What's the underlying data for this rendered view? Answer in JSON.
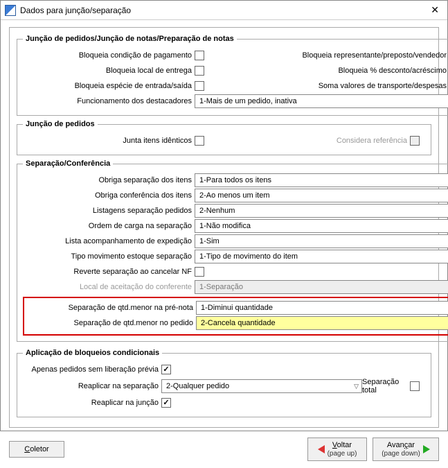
{
  "window": {
    "title": "Dados para junção/separação"
  },
  "group1": {
    "legend": "Junção de pedidos/Junção de notas/Preparação de notas",
    "left": {
      "l1": "Bloqueia condição de pagamento",
      "l2": "Bloqueia local de entrega",
      "l3": "Bloqueia espécie de entrada/saída",
      "l4": "Funcionamento dos destacadores"
    },
    "right": {
      "r1": "Bloqueia representante/preposto/vendedor",
      "r2": "Bloqueia % desconto/acréscimo",
      "r3": "Soma valores de transporte/despesas"
    },
    "sel_destacadores": "1-Mais de um pedido, inativa"
  },
  "group2": {
    "legend": "Junção de pedidos",
    "junta": "Junta itens idênticos",
    "considera": "Considera referência"
  },
  "group3": {
    "legend": "Separação/Conferência",
    "rows": {
      "r1l": "Obriga separação dos itens",
      "r1v": "1-Para todos os itens",
      "r2l": "Obriga conferência dos itens",
      "r2v": "2-Ao menos um item",
      "r3l": "Listagens separação pedidos",
      "r3v": "2-Nenhum",
      "r4l": "Ordem de carga na separação",
      "r4v": "1-Não modifica",
      "r5l": "Lista acompanhamento de expedição",
      "r5v": "1-Sim",
      "r6l": "Tipo movimento estoque separação",
      "r6v": "1-Tipo de movimento do item",
      "r7l": "Reverte separação ao cancelar NF",
      "r8l": "Local de aceitação do conferente",
      "r8v": "1-Separação",
      "r9l": "Separação de qtd.menor na pré-nota",
      "r9v": "1-Diminui quantidade",
      "r10l": "Separação de qtd.menor no pedido",
      "r10v": "2-Cancela quantidade"
    }
  },
  "group4": {
    "legend": "Aplicação de bloqueios condicionais",
    "l1": "Apenas pedidos sem liberação prévia",
    "l2": "Reaplicar na separação",
    "l2v": "2-Qualquer pedido",
    "l3": "Reaplicar na junção",
    "sep_total": "Separação total"
  },
  "footer": {
    "coletor_u": "C",
    "coletor": "oletor",
    "voltar_u": "V",
    "voltar": "oltar",
    "voltar_sub": "(page up)",
    "avancar": "Avan",
    "avancar_u": "ç",
    "avancar2": "ar",
    "avancar_sub": "(page down)"
  }
}
